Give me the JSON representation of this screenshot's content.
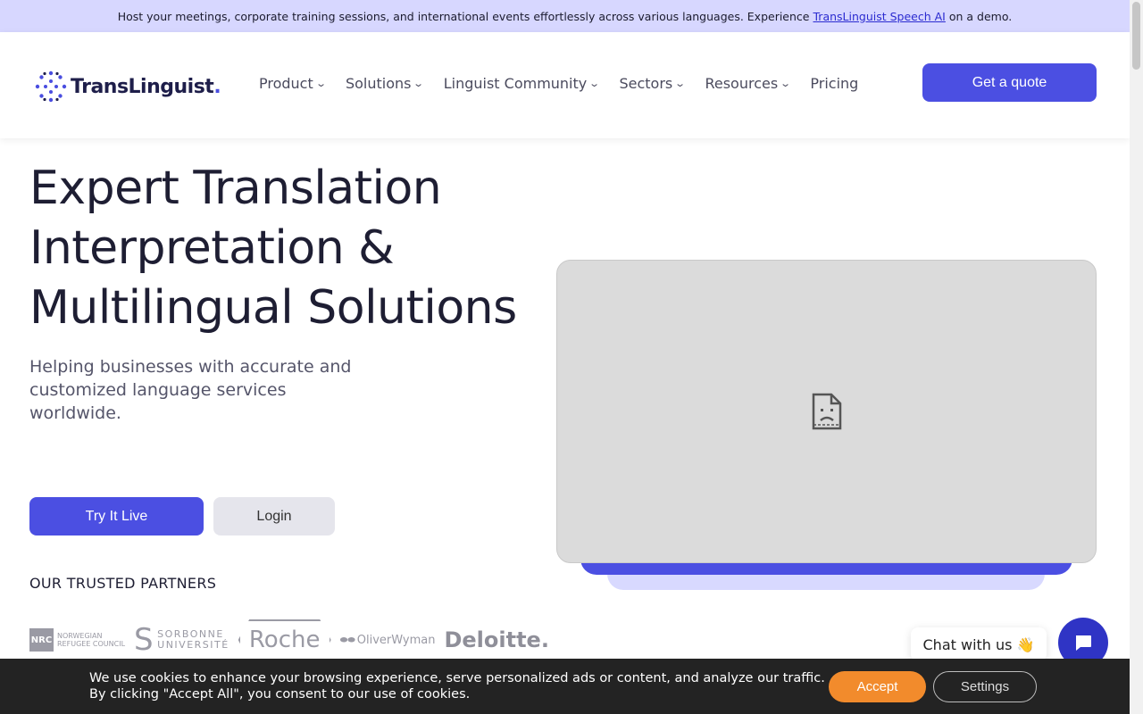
{
  "announcement": {
    "text_before": "Host your meetings, corporate training sessions, and international events effortlessly across various languages. Experience",
    "link": "TransLinguist Speech AI",
    "text_after": "on a demo."
  },
  "header": {
    "logo_text": "TransLinguist",
    "logo_dot": ".",
    "nav": [
      {
        "label": "Product",
        "has_dropdown": true
      },
      {
        "label": "Solutions",
        "has_dropdown": true
      },
      {
        "label": "Linguist Community",
        "has_dropdown": true
      },
      {
        "label": "Sectors",
        "has_dropdown": true
      },
      {
        "label": "Resources",
        "has_dropdown": true
      },
      {
        "label": "Pricing",
        "has_dropdown": false
      }
    ],
    "cta_label": "Get a quote"
  },
  "hero": {
    "title_lines": [
      "Expert Translation",
      "Interpretation &",
      "Multilingual Solutions"
    ],
    "subtitle": "Helping businesses with accurate and customized language services worldwide.",
    "primary_cta": "Try It Live",
    "secondary_cta": "Login"
  },
  "partners": {
    "title": "OUR TRUSTED PARTNERS",
    "logos": {
      "nrc_box": "NRC",
      "nrc_line1": "NORWEGIAN",
      "nrc_line2": "REFUGEE COUNCIL",
      "sorbonne_s": "S",
      "sorbonne_line1": "SORBONNE",
      "sorbonne_line2": "UNIVERSITÉ",
      "roche": "Roche",
      "oliver": "OliverWyman",
      "deloitte": "Deloitte."
    }
  },
  "video": {
    "icon": "broken-image-icon"
  },
  "chat": {
    "label": "Chat with us",
    "emoji": "👋"
  },
  "cookie": {
    "line1": "We use cookies to enhance your browsing experience, serve personalized ads or content, and analyze our traffic.",
    "line2": "By clicking \"Accept All\", you consent to our use of cookies.",
    "accept": "Accept",
    "settings": "Settings"
  },
  "colors": {
    "brand": "#4b4fe2",
    "accent": "#f28b2c",
    "announce_bg": "#d7d7ff"
  }
}
